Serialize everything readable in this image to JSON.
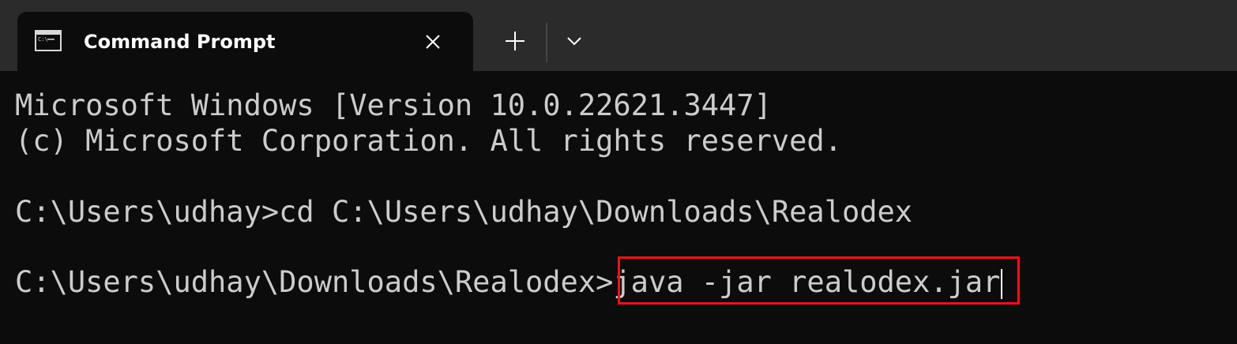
{
  "tab": {
    "title": "Command Prompt",
    "icon": "cmd-icon"
  },
  "titlebar": {
    "new_tab_icon": "plus-icon",
    "dropdown_icon": "chevron-down-icon"
  },
  "console": {
    "line1": "Microsoft Windows [Version 10.0.22621.3447]",
    "line2": "(c) Microsoft Corporation. All rights reserved.",
    "line3_prompt": "C:\\Users\\udhay>",
    "line3_command": "cd C:\\Users\\udhay\\Downloads\\Realodex",
    "line4_prompt": "C:\\Users\\udhay\\Downloads\\Realodex>",
    "line4_command": "java -jar realodex.jar"
  },
  "colors": {
    "background": "#0c0c0c",
    "titlebar": "#2b2b2b",
    "text": "#cccccc",
    "highlight": "#e8141c"
  }
}
